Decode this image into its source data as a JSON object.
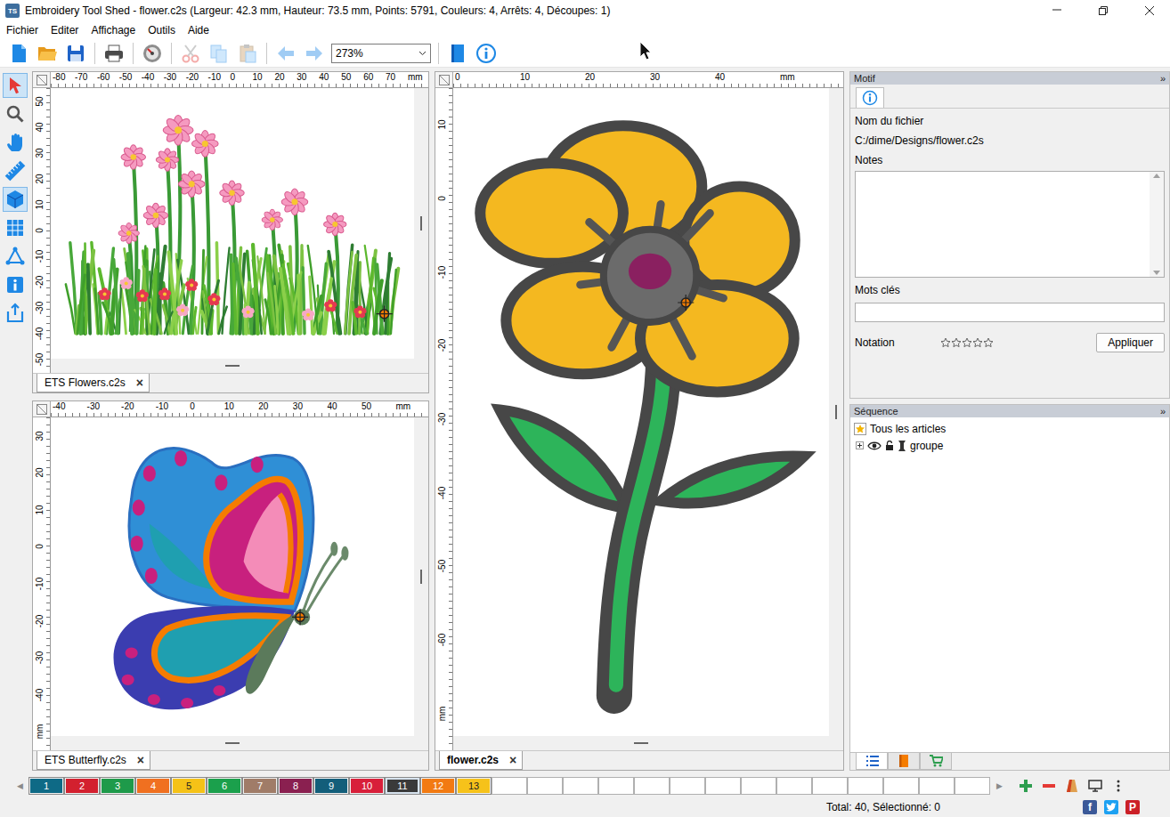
{
  "window": {
    "title": "Embroidery Tool Shed - flower.c2s (Largeur: 42.3 mm, Hauteur: 73.5 mm, Points: 5791, Couleurs: 4, Arrêts: 4, Découpes: 1)",
    "logo": "TS"
  },
  "menu": [
    "Fichier",
    "Editer",
    "Affichage",
    "Outils",
    "Aide"
  ],
  "toolbar": [
    {
      "kind": "new",
      "disabled": false
    },
    {
      "kind": "open",
      "disabled": false
    },
    {
      "kind": "save",
      "disabled": false
    },
    {
      "kind": "separator"
    },
    {
      "kind": "print",
      "disabled": false
    },
    {
      "kind": "separator"
    },
    {
      "kind": "player",
      "disabled": false
    },
    {
      "kind": "separator"
    },
    {
      "kind": "cut",
      "disabled": true
    },
    {
      "kind": "copy",
      "disabled": true
    },
    {
      "kind": "paste",
      "disabled": true
    },
    {
      "kind": "separator"
    },
    {
      "kind": "back",
      "disabled": true
    },
    {
      "kind": "forward",
      "disabled": true
    },
    {
      "kind": "zoom",
      "value": "273%"
    },
    {
      "kind": "separator"
    },
    {
      "kind": "book",
      "disabled": false
    },
    {
      "kind": "info",
      "disabled": false
    }
  ],
  "tools": [
    {
      "kind": "select",
      "selected": true
    },
    {
      "kind": "zoom",
      "selected": false
    },
    {
      "kind": "pan",
      "selected": false
    },
    {
      "kind": "measure",
      "selected": false
    },
    {
      "kind": "3d",
      "selected": true
    },
    {
      "kind": "grid",
      "selected": false
    },
    {
      "kind": "nodes",
      "selected": false
    },
    {
      "kind": "info",
      "selected": false
    },
    {
      "kind": "exit",
      "selected": false
    }
  ],
  "panes": [
    {
      "kind": "garden",
      "tab": {
        "label": "ETS Flowers.c2s",
        "selected": false,
        "close": "×"
      },
      "ruler_top": [
        "-80",
        "-70",
        "-60",
        "-50",
        "-40",
        "-30",
        "-20",
        "-10",
        "0",
        "10",
        "20",
        "30",
        "40",
        "50",
        "60",
        "70",
        "mm"
      ],
      "ruler_left": [
        "50",
        "40",
        "30",
        "20",
        "10",
        "0",
        "-10",
        "-20",
        "-30",
        "-40",
        "-50"
      ]
    },
    {
      "kind": "butterfly",
      "tab": {
        "label": "ETS Butterfly.c2s",
        "selected": false,
        "close": "×"
      },
      "ruler_top": [
        "-40",
        "-30",
        "-20",
        "-10",
        "0",
        "10",
        "20",
        "30",
        "40",
        "50",
        "mm"
      ],
      "ruler_left": [
        "30",
        "20",
        "10",
        "0",
        "-10",
        "-20",
        "-30",
        "-40",
        "mm"
      ]
    },
    {
      "kind": "flower",
      "tab": {
        "label": "flower.c2s",
        "selected": true,
        "close": "×"
      },
      "ruler_top": [
        "0",
        "10",
        "20",
        "30",
        "40",
        "mm"
      ],
      "ruler_left": [
        "10",
        "0",
        "-10",
        "-20",
        "-30",
        "-40",
        "-50",
        "-60",
        "mm"
      ]
    }
  ],
  "motif": {
    "header": "Motif",
    "collapse": "»",
    "tabs": [
      {
        "kind": "info",
        "selected": true
      }
    ],
    "filename_label": "Nom du fichier",
    "filename": "C:/dime/Designs/flower.c2s",
    "notes_label": "Notes",
    "keywords_label": "Mots clés",
    "rating_label": "Notation",
    "stars": 0,
    "apply": "Appliquer"
  },
  "sequence": {
    "header": "Séquence",
    "collapse": "»",
    "items": [
      {
        "kind": "root",
        "label": "Tous les articles"
      },
      {
        "kind": "group",
        "label": "groupe",
        "expanded": false,
        "visible": true,
        "locked": false
      }
    ],
    "tabs": [
      {
        "kind": "list",
        "selected": true
      },
      {
        "kind": "book",
        "selected": false
      },
      {
        "kind": "cart",
        "selected": false
      }
    ]
  },
  "palette": {
    "scroll_left": "◀",
    "scroll_right": "▶",
    "colors": [
      {
        "label": "1",
        "color": "#0e6a86",
        "selected": false
      },
      {
        "label": "2",
        "color": "#d3202f",
        "selected": false
      },
      {
        "label": "3",
        "color": "#1e9a4a",
        "selected": false
      },
      {
        "label": "4",
        "color": "#f07020",
        "selected": false
      },
      {
        "label": "5",
        "color": "#f5c217",
        "selected": false
      },
      {
        "label": "6",
        "color": "#1ba04c",
        "selected": false
      },
      {
        "label": "7",
        "color": "#a07c68",
        "selected": false
      },
      {
        "label": "8",
        "color": "#8a2050",
        "selected": false
      },
      {
        "label": "9",
        "color": "#135e7a",
        "selected": false
      },
      {
        "label": "10",
        "color": "#d81f3a",
        "selected": false
      },
      {
        "label": "11",
        "color": "#3a3a3a",
        "selected": true
      },
      {
        "label": "12",
        "color": "#f27a12",
        "selected": false
      },
      {
        "label": "13",
        "color": "#f6c21a",
        "selected": false
      }
    ]
  },
  "status": "Total: 40, Sélectionné: 0",
  "social": [
    {
      "kind": "facebook",
      "glyph": "f",
      "color": "#3b5998"
    },
    {
      "kind": "twitter",
      "color": "#1da1f2"
    },
    {
      "kind": "pinterest",
      "glyph": "P",
      "color": "#cb2027"
    }
  ]
}
